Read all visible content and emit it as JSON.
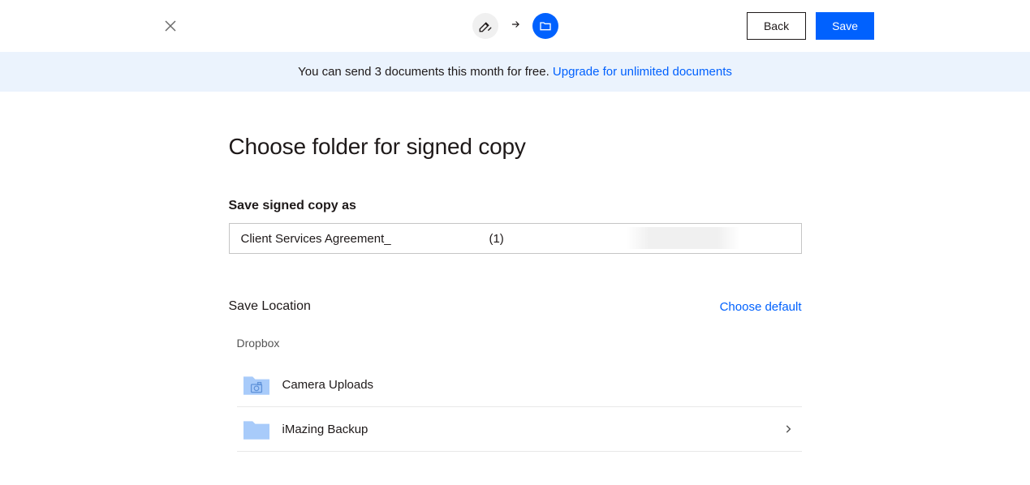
{
  "header": {
    "back_label": "Back",
    "save_label": "Save"
  },
  "banner": {
    "text": "You can send 3 documents this month for free. ",
    "link_text": "Upgrade for unlimited documents"
  },
  "page": {
    "title": "Choose folder for signed copy",
    "filename_label": "Save signed copy as",
    "filename_value": "Client Services Agreement_                             (1)",
    "location_label": "Save Location",
    "choose_default_label": "Choose default",
    "breadcrumb": "Dropbox",
    "folders": [
      {
        "name": "Camera Uploads",
        "type": "camera",
        "expandable": false
      },
      {
        "name": "iMazing Backup",
        "type": "folder",
        "expandable": true
      }
    ]
  }
}
